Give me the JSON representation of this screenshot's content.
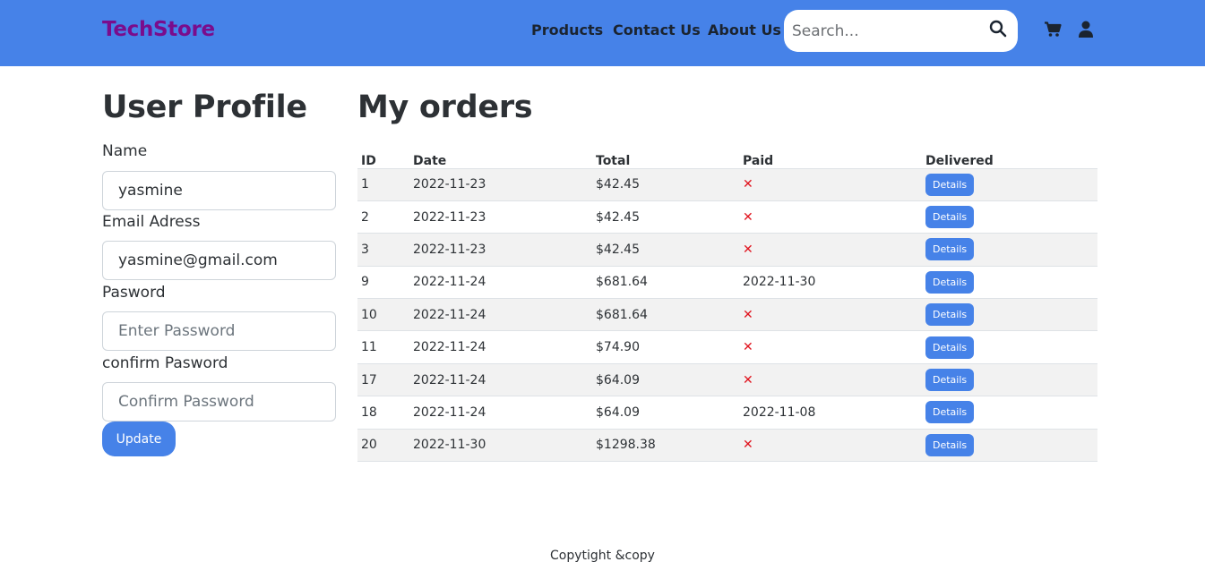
{
  "navbar": {
    "brand": "TechStore",
    "links": [
      "Products",
      "Contact Us",
      "About Us"
    ],
    "search_placeholder": "Search...",
    "icons": [
      "search-icon",
      "cart-icon",
      "user-icon"
    ],
    "background_color": "#4682e8",
    "brand_color": "#7a0c8c"
  },
  "profile": {
    "title": "User Profile",
    "name_label": "Name",
    "name_value": "yasmine",
    "email_label": "Email Adress",
    "email_value": "yasmine@gmail.com",
    "password_label": "Pasword",
    "password_placeholder": "Enter Password",
    "confirm_label": "confirm Pasword",
    "confirm_placeholder": "Confirm Password",
    "update_label": "Update"
  },
  "orders": {
    "title": "My orders",
    "columns": [
      "ID",
      "Date",
      "Total",
      "Paid",
      "Delivered"
    ],
    "details_label": "Details",
    "unpaid_mark": "✕",
    "rows": [
      {
        "id": "1",
        "date": "2022-11-23",
        "total": "$42.45",
        "paid": ""
      },
      {
        "id": "2",
        "date": "2022-11-23",
        "total": "$42.45",
        "paid": ""
      },
      {
        "id": "3",
        "date": "2022-11-23",
        "total": "$42.45",
        "paid": ""
      },
      {
        "id": "9",
        "date": "2022-11-24",
        "total": "$681.64",
        "paid": "2022-11-30"
      },
      {
        "id": "10",
        "date": "2022-11-24",
        "total": "$681.64",
        "paid": ""
      },
      {
        "id": "11",
        "date": "2022-11-24",
        "total": "$74.90",
        "paid": ""
      },
      {
        "id": "17",
        "date": "2022-11-24",
        "total": "$64.09",
        "paid": ""
      },
      {
        "id": "18",
        "date": "2022-11-24",
        "total": "$64.09",
        "paid": "2022-11-08"
      },
      {
        "id": "20",
        "date": "2022-11-30",
        "total": "$1298.38",
        "paid": ""
      }
    ],
    "unpaid_color": "#e0141e"
  },
  "footer": {
    "text": "Copytight &copy"
  }
}
